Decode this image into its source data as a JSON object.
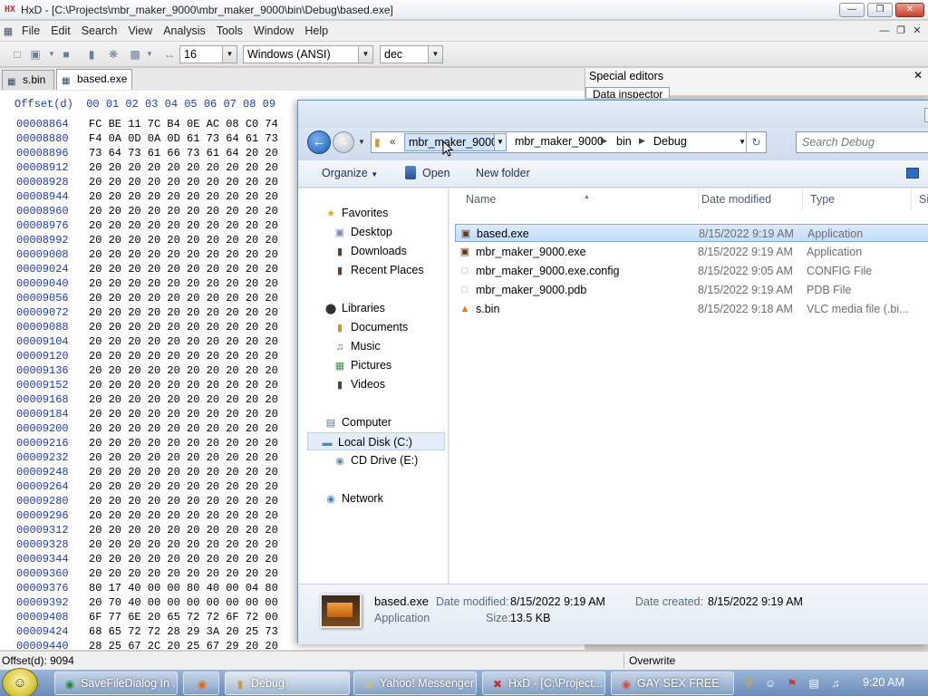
{
  "hxd": {
    "title": "HxD - [C:\\Projects\\mbr_maker_9000\\mbr_maker_9000\\bin\\Debug\\based.exe]",
    "menu": [
      "File",
      "Edit",
      "Search",
      "View",
      "Analysis",
      "Tools",
      "Window",
      "Help"
    ],
    "toolbar": {
      "bytes_per_row": "16",
      "charset": "Windows (ANSI)",
      "offset_base": "dec"
    },
    "tabs": [
      {
        "label": "s.bin"
      },
      {
        "label": "based.exe"
      }
    ],
    "special_editors": {
      "title": "Special editors",
      "tab": "Data inspector"
    },
    "hex_header": "Offset(d)  00 01 02 03 04 05 06 07 08 09",
    "hex_rows": [
      {
        "offset": "00008864",
        "bytes": "FC BE 11 7C B4 0E AC 08 C0 74"
      },
      {
        "offset": "00008880",
        "bytes": "F4 0A 0D 0A 0D 61 73 64 61 73"
      },
      {
        "offset": "00008896",
        "bytes": "73 64 73 61 66 73 61 64 20 20"
      },
      {
        "offset": "00008912",
        "bytes": "20 20 20 20 20 20 20 20 20 20"
      },
      {
        "offset": "00008928",
        "bytes": "20 20 20 20 20 20 20 20 20 20"
      },
      {
        "offset": "00008944",
        "bytes": "20 20 20 20 20 20 20 20 20 20"
      },
      {
        "offset": "00008960",
        "bytes": "20 20 20 20 20 20 20 20 20 20"
      },
      {
        "offset": "00008976",
        "bytes": "20 20 20 20 20 20 20 20 20 20"
      },
      {
        "offset": "00008992",
        "bytes": "20 20 20 20 20 20 20 20 20 20"
      },
      {
        "offset": "00009008",
        "bytes": "20 20 20 20 20 20 20 20 20 20"
      },
      {
        "offset": "00009024",
        "bytes": "20 20 20 20 20 20 20 20 20 20"
      },
      {
        "offset": "00009040",
        "bytes": "20 20 20 20 20 20 20 20 20 20"
      },
      {
        "offset": "00009056",
        "bytes": "20 20 20 20 20 20 20 20 20 20"
      },
      {
        "offset": "00009072",
        "bytes": "20 20 20 20 20 20 20 20 20 20"
      },
      {
        "offset": "00009088",
        "bytes": "20 20 20 20 20 20 20 20 20 20"
      },
      {
        "offset": "00009104",
        "bytes": "20 20 20 20 20 20 20 20 20 20"
      },
      {
        "offset": "00009120",
        "bytes": "20 20 20 20 20 20 20 20 20 20"
      },
      {
        "offset": "00009136",
        "bytes": "20 20 20 20 20 20 20 20 20 20"
      },
      {
        "offset": "00009152",
        "bytes": "20 20 20 20 20 20 20 20 20 20"
      },
      {
        "offset": "00009168",
        "bytes": "20 20 20 20 20 20 20 20 20 20"
      },
      {
        "offset": "00009184",
        "bytes": "20 20 20 20 20 20 20 20 20 20"
      },
      {
        "offset": "00009200",
        "bytes": "20 20 20 20 20 20 20 20 20 20"
      },
      {
        "offset": "00009216",
        "bytes": "20 20 20 20 20 20 20 20 20 20"
      },
      {
        "offset": "00009232",
        "bytes": "20 20 20 20 20 20 20 20 20 20"
      },
      {
        "offset": "00009248",
        "bytes": "20 20 20 20 20 20 20 20 20 20"
      },
      {
        "offset": "00009264",
        "bytes": "20 20 20 20 20 20 20 20 20 20"
      },
      {
        "offset": "00009280",
        "bytes": "20 20 20 20 20 20 20 20 20 20"
      },
      {
        "offset": "00009296",
        "bytes": "20 20 20 20 20 20 20 20 20 20"
      },
      {
        "offset": "00009312",
        "bytes": "20 20 20 20 20 20 20 20 20 20"
      },
      {
        "offset": "00009328",
        "bytes": "20 20 20 20 20 20 20 20 20 20"
      },
      {
        "offset": "00009344",
        "bytes": "20 20 20 20 20 20 20 20 20 20"
      },
      {
        "offset": "00009360",
        "bytes": "20 20 20 20 20 20 20 20 20 20"
      },
      {
        "offset": "00009376",
        "bytes": "80 17 40 00 00 80 40 00 04 80"
      },
      {
        "offset": "00009392",
        "bytes": "20 70 40 00 00 00 00 00 00 00"
      },
      {
        "offset": "00009408",
        "bytes": "6F 77 6E 20 65 72 72 6F 72 00"
      },
      {
        "offset": "00009424",
        "bytes": "68 65 72 72 28 29 3A 20 25 73"
      },
      {
        "offset": "00009440",
        "bytes": "28 25 67 2C 20 25 67 29 20 20"
      }
    ],
    "status": {
      "offset": "Offset(d): 9094",
      "mode": "Overwrite"
    }
  },
  "dialog": {
    "breadcrumb": {
      "selected": "mbr_maker_9000",
      "parts": [
        "mbr_maker_9000",
        "bin",
        "Debug"
      ]
    },
    "search_placeholder": "Search Debug",
    "commands": {
      "organize": "Organize",
      "open": "Open",
      "new_folder": "New folder"
    },
    "nav": {
      "favorites": "Favorites",
      "desktop": "Desktop",
      "downloads": "Downloads",
      "recent": "Recent Places",
      "libraries": "Libraries",
      "documents": "Documents",
      "music": "Music",
      "pictures": "Pictures",
      "videos": "Videos",
      "computer": "Computer",
      "local_disk": "Local Disk (C:)",
      "cd_drive": "CD Drive (E:)",
      "network": "Network"
    },
    "columns": {
      "name": "Name",
      "date": "Date modified",
      "type": "Type",
      "size": "Si"
    },
    "files": [
      {
        "name": "based.exe",
        "date": "8/15/2022 9:19 AM",
        "type": "Application"
      },
      {
        "name": "mbr_maker_9000.exe",
        "date": "8/15/2022 9:19 AM",
        "type": "Application"
      },
      {
        "name": "mbr_maker_9000.exe.config",
        "date": "8/15/2022 9:05 AM",
        "type": "CONFIG File"
      },
      {
        "name": "mbr_maker_9000.pdb",
        "date": "8/15/2022 9:19 AM",
        "type": "PDB File"
      },
      {
        "name": "s.bin",
        "date": "8/15/2022 9:18 AM",
        "type": "VLC media file (.bi..."
      }
    ],
    "details": {
      "name": "based.exe",
      "type": "Application",
      "modified_label": "Date modified:",
      "modified": "8/15/2022 9:19 AM",
      "size_label": "Size:",
      "size": "13.5 KB",
      "created_label": "Date created:",
      "created": "8/15/2022 9:19 AM"
    }
  },
  "taskbar": {
    "tasks": [
      "SaveFileDialog In ...",
      "Debug",
      "Yahoo! Messenger",
      "HxD - [C:\\Project...",
      "GAY SEX FREE"
    ],
    "clock": "9:20 AM"
  }
}
